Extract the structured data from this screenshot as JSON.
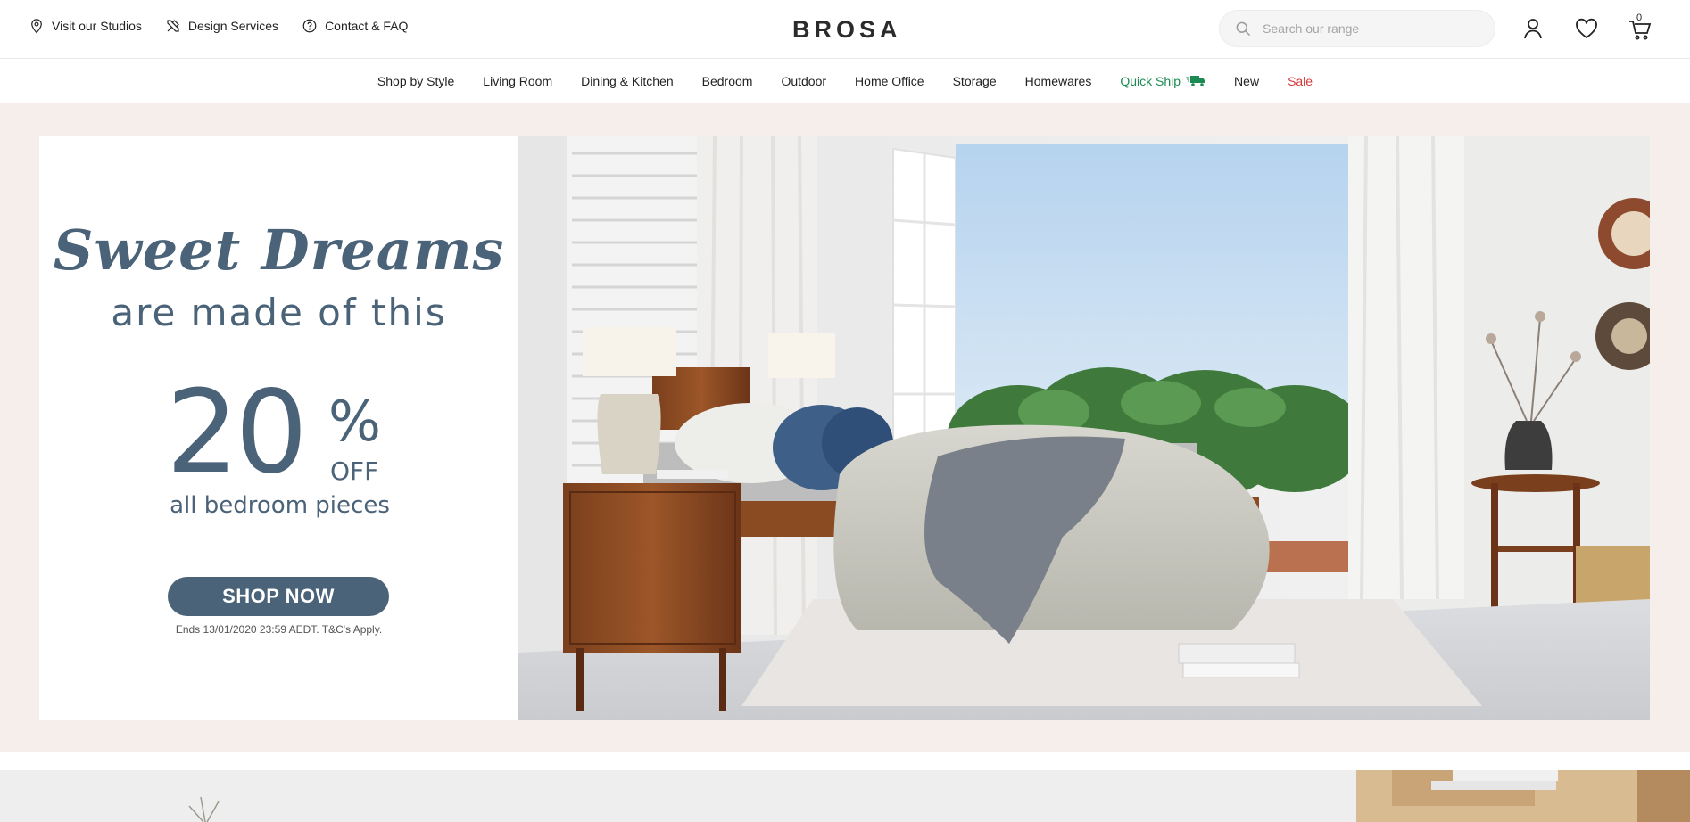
{
  "utility_links": [
    {
      "label": "Visit our Studios",
      "icon": "map-pin-icon"
    },
    {
      "label": "Design Services",
      "icon": "tools-icon"
    },
    {
      "label": "Contact & FAQ",
      "icon": "question-icon"
    }
  ],
  "logo": "BROSA",
  "search": {
    "placeholder": "Search our range"
  },
  "cart": {
    "count": "0"
  },
  "nav": {
    "items": [
      "Shop by Style",
      "Living Room",
      "Dining & Kitchen",
      "Bedroom",
      "Outdoor",
      "Home Office",
      "Storage",
      "Homewares"
    ],
    "quick_ship": "Quick Ship",
    "new": "New",
    "sale": "Sale"
  },
  "promo": {
    "script_title": "Sweet Dreams",
    "subtitle": "are made of this",
    "discount_number": "20",
    "discount_symbol": "%",
    "discount_off": "OFF",
    "discount_scope": "all bedroom pieces",
    "cta": "SHOP NOW",
    "terms": "Ends 13/01/2020 23:59 AEDT. T&C's Apply."
  },
  "colors": {
    "promo_blue": "#4a6378",
    "hero_bg": "#f6eeea",
    "quick_ship": "#1c8a53",
    "sale": "#d63a3a"
  }
}
